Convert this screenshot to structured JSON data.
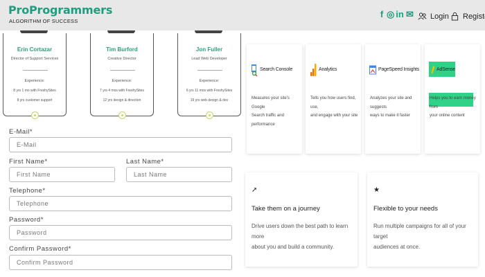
{
  "header": {
    "brand": "ProProgrammers",
    "tagline": "ALGORITHM OF SUCCESS",
    "socials": [
      {
        "icon": "facebook-icon",
        "glyph": "f"
      },
      {
        "icon": "instagram-icon",
        "glyph": "◎"
      },
      {
        "icon": "linkedin-icon",
        "glyph": "in"
      },
      {
        "icon": "mail-icon",
        "glyph": "✉"
      }
    ],
    "login_label": "Login",
    "register_label": "Register"
  },
  "team": [
    {
      "name": "Erin Cortazar",
      "role": "Director of Support Services",
      "exp_label": "Experience:",
      "line1": "8 yrs 1 mo with FreshySites",
      "line2": "8 yrs customer support"
    },
    {
      "name": "Tim Burford",
      "role": "Creative Director",
      "exp_label": "Experience:",
      "line1": "7 yrs 4 mos with FreshySites",
      "line2": "12 yrs design & direction"
    },
    {
      "name": "Jon Fuller",
      "role": "Lead Web Developer",
      "exp_label": "Experience:",
      "line1": "6 yrs 11 mos with FreshySites",
      "line2": "19 yrs web design & dev"
    }
  ],
  "form": {
    "email": {
      "label": "E-Mail*",
      "placeholder": "E-Mail"
    },
    "first_name": {
      "label": "First Name*",
      "placeholder": "First Name"
    },
    "last_name": {
      "label": "Last Name*",
      "placeholder": "Last Name"
    },
    "telephone": {
      "label": "Telephone*",
      "placeholder": "Telephone"
    },
    "password": {
      "label": "Password*",
      "placeholder": "Password"
    },
    "confirm_password": {
      "label": "Confirm Password*",
      "placeholder": "Confirm Password"
    }
  },
  "tools": [
    {
      "name": "Search Console",
      "icon": "search-console-icon",
      "desc1": "Measures your site's Google",
      "desc2": "Search traffic and performance"
    },
    {
      "name": "Analytics",
      "icon": "analytics-icon",
      "desc1": "Tells you how users find, use,",
      "desc2": "and engage with your site"
    },
    {
      "name": "PageSpeed Insights",
      "icon": "pagespeed-icon",
      "desc1": "Analyzes your site and suggests",
      "desc2": "ways to make it faster"
    },
    {
      "name": "AdSense",
      "icon": "adsense-icon",
      "desc1": "Helps you to earn money from",
      "desc2": "your online content"
    }
  ],
  "features": [
    {
      "icon": "trending-up-icon",
      "glyph": "➚",
      "title": "Take them on a journey",
      "desc1": "Drive users down the best path to learn more",
      "desc2": "about you and build a community."
    },
    {
      "icon": "star-icon",
      "glyph": "★",
      "title": "Flexible to your needs",
      "desc1": "Run multiple campaigns for all of your target",
      "desc2": "audiences at once."
    }
  ],
  "colors": {
    "brand": "#1f9e7f",
    "team_name": "#2aa17a",
    "adsense_highlight": "#2fd286"
  }
}
